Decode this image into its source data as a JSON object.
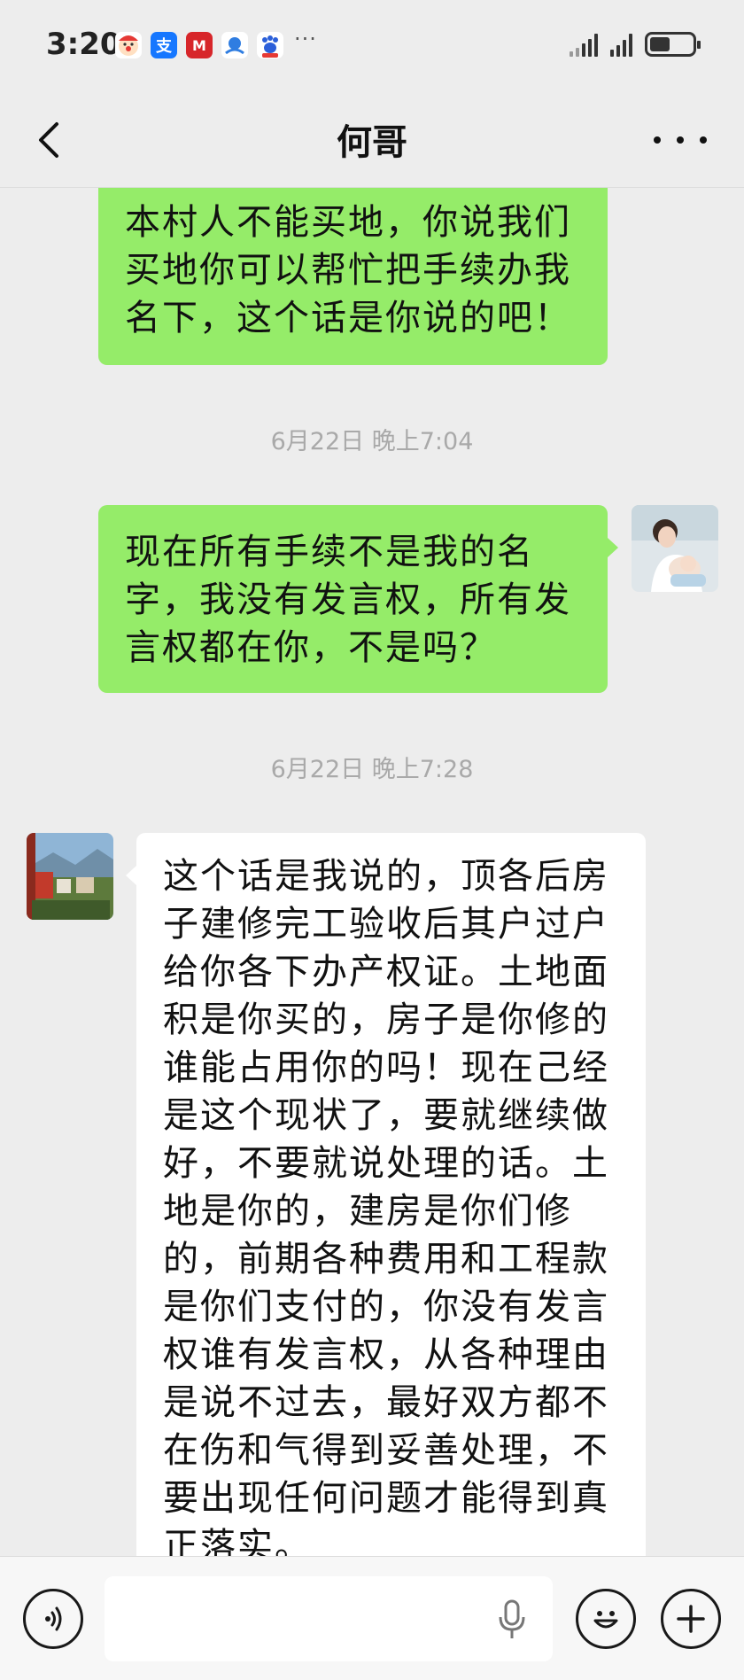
{
  "status_bar": {
    "time": "3:20",
    "apps": [
      {
        "icon": "clown-app-icon",
        "glyph": "🤡",
        "color": "#ffffff"
      },
      {
        "icon": "alipay-icon",
        "glyph": "支",
        "color": "#1677ff"
      },
      {
        "icon": "china-merchants-bank-icon",
        "glyph": "M",
        "color": "#d7262a"
      },
      {
        "icon": "ctrip-icon",
        "glyph": "●",
        "color": "#ffffff"
      },
      {
        "icon": "baidu-icon",
        "glyph": "🐾",
        "color": "#ffffff"
      }
    ],
    "more": "···"
  },
  "header": {
    "title": "何哥"
  },
  "messages": [
    {
      "type": "out",
      "text": "本村人不能买地，你说我们买地你可以帮忙把手续办我名下，这个话是你说的吧！"
    },
    {
      "type": "time",
      "text": "6月22日 晚上7:04"
    },
    {
      "type": "out",
      "text": "现在所有手续不是我的名字，我没有发言权，所有发言权都在你，不是吗？"
    },
    {
      "type": "time",
      "text": "6月22日 晚上7:28"
    },
    {
      "type": "in",
      "text": "这个话是我说的，顶各后房子建修完工验收后其户过户给你各下办产权证。土地面积是你买的，房子是你修的谁能占用你的吗！现在己经是这个现状了，要就继续做好，不要就说处理的话。土地是你的，建房是你们修的，前期各种费用和工程款是你们支付的，你没有发言权谁有发言权，从各种理由是说不过去，最好双方都不在伤和气得到妥善处理，不要出现任何问题才能得到真正落实。"
    }
  ],
  "colors": {
    "outgoing_bubble": "#95ec69",
    "incoming_bubble": "#ffffff",
    "background": "#ededed"
  }
}
